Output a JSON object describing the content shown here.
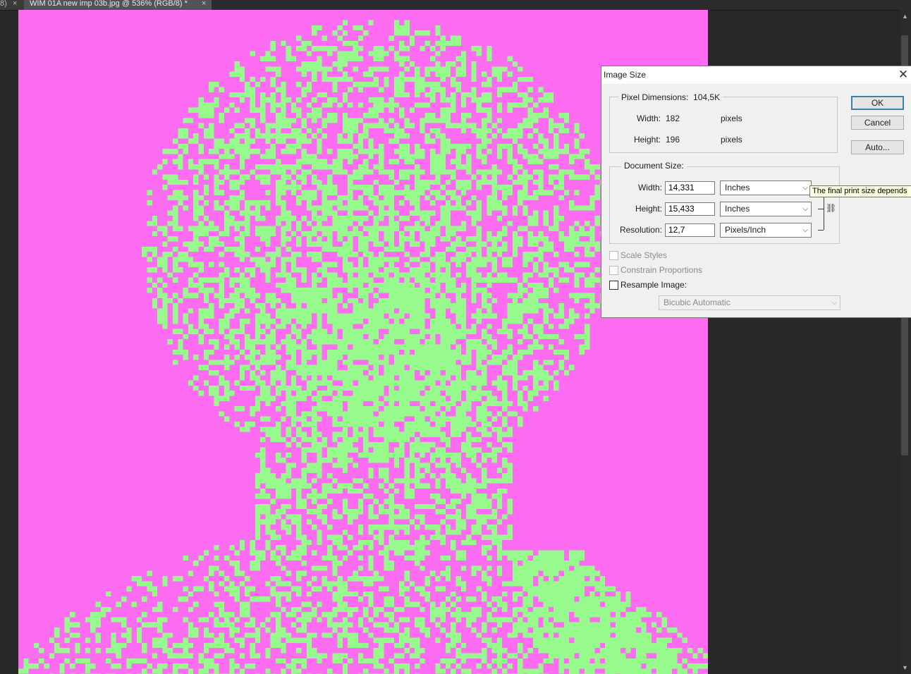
{
  "tabs": [
    {
      "label": "8)",
      "close": "×"
    },
    {
      "label": "WIM 01A new imp 03b.jpg @ 536% (RGB/8) *",
      "close": "×"
    }
  ],
  "canvas": {
    "background": "#fe6cf1",
    "foreground": "#96fb8c"
  },
  "dialog": {
    "title": "Image Size",
    "close_icon": "✕",
    "pixel_dimensions": {
      "legend": "Pixel Dimensions:",
      "size": "104,5K",
      "width_label": "Width:",
      "width_value": "182",
      "width_unit": "pixels",
      "height_label": "Height:",
      "height_value": "196",
      "height_unit": "pixels"
    },
    "document_size": {
      "legend": "Document Size:",
      "width_label": "Width:",
      "width_value": "14,331",
      "width_unit": "Inches",
      "height_label": "Height:",
      "height_value": "15,433",
      "height_unit": "Inches",
      "resolution_label": "Resolution:",
      "resolution_value": "12,7",
      "resolution_unit": "Pixels/Inch"
    },
    "options": {
      "scale_styles": "Scale Styles",
      "constrain_proportions": "Constrain Proportions",
      "resample_image": "Resample Image:",
      "resample_method": "Bicubic Automatic"
    },
    "buttons": {
      "ok": "OK",
      "cancel": "Cancel",
      "auto": "Auto..."
    },
    "tooltip": "The final print size depends"
  },
  "icons": {
    "chevron": "⌵",
    "link": "⛓",
    "scroll_up": "▲",
    "scroll_down": "▼"
  }
}
